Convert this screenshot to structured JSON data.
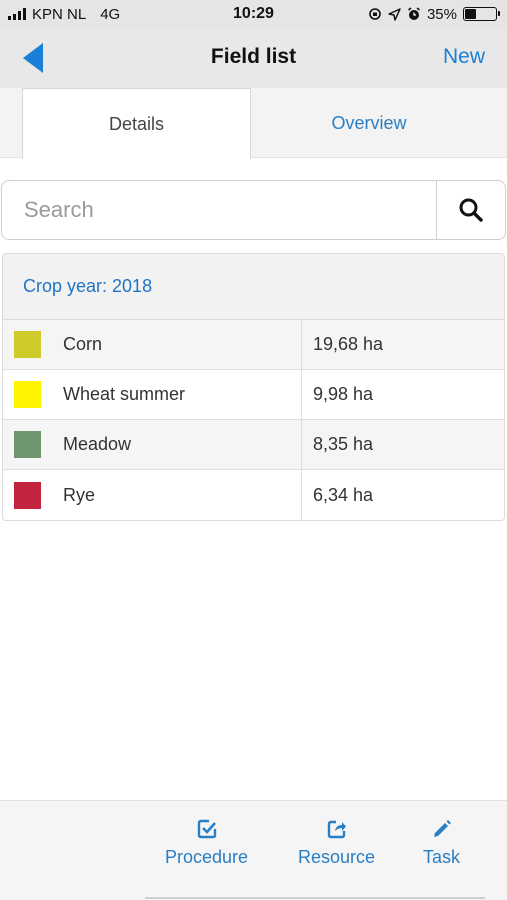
{
  "status_bar": {
    "carrier": "KPN NL",
    "network": "4G",
    "time": "10:29",
    "battery_percent": "35%",
    "battery_level": 0.35
  },
  "nav": {
    "title": "Field list",
    "new_label": "New",
    "accent_color": "#1a7fd6"
  },
  "tabs": [
    {
      "label": "Details",
      "active": true
    },
    {
      "label": "Overview",
      "active": false
    }
  ],
  "search": {
    "placeholder": "Search",
    "value": ""
  },
  "crop_panel": {
    "heading": "Crop year: 2018",
    "rows": [
      {
        "name": "Corn",
        "area": "19,68 ha",
        "color": "#cfcb2a"
      },
      {
        "name": "Wheat summer",
        "area": "9,98 ha",
        "color": "#fff500"
      },
      {
        "name": "Meadow",
        "area": "8,35 ha",
        "color": "#6e9470"
      },
      {
        "name": "Rye",
        "area": "6,34 ha",
        "color": "#c2233f"
      }
    ]
  },
  "toolbar": {
    "procedure_label": "Procedure",
    "resource_label": "Resource",
    "task_label": "Task"
  }
}
